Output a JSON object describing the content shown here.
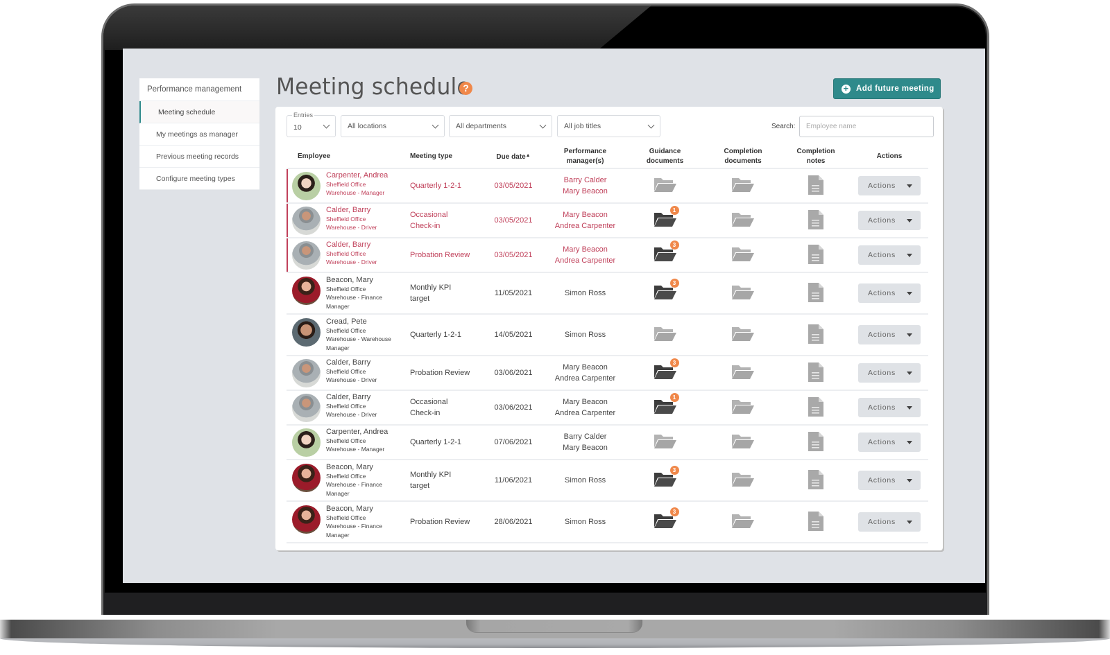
{
  "sidebar": {
    "header": "Performance management",
    "items": [
      {
        "label": "Meeting schedule",
        "active": true
      },
      {
        "label": "My meetings as manager",
        "active": false
      },
      {
        "label": "Previous meeting records",
        "active": false
      },
      {
        "label": "Configure meeting types",
        "active": false
      }
    ]
  },
  "header": {
    "title": "Meeting schedule",
    "help_icon": "?",
    "add_button_label": "Add future meeting",
    "add_button_icon": "plus-circle-icon"
  },
  "filters": {
    "entries_legend": "Entries",
    "entries_value": "10",
    "location": "All locations",
    "department": "All departments",
    "job_title": "All job titles",
    "search_label": "Search:",
    "search_placeholder": "Employee name",
    "search_value": ""
  },
  "table": {
    "columns": [
      "Employee",
      "Meeting type",
      "Due date",
      [
        "Performance",
        "manager(s)"
      ],
      [
        "Guidance",
        "documents"
      ],
      [
        "Completion",
        "documents"
      ],
      [
        "Completion",
        "notes"
      ],
      "Actions"
    ],
    "sort_column": "Due date",
    "sort_direction": "ascending",
    "action_label": "Actions",
    "rows": [
      {
        "name": "Carpenter, Andrea",
        "office": "Sheffield Office",
        "role": [
          "Warehouse - Manager"
        ],
        "avatar": "andrea",
        "type": [
          "Quarterly 1-2-1"
        ],
        "due": "03/05/2021",
        "managers": [
          "Barry Calder",
          "Mary Beacon"
        ],
        "guidance_count": 0,
        "overdue": true
      },
      {
        "name": "Calder, Barry",
        "office": "Sheffield Office",
        "role": [
          "Warehouse - Driver"
        ],
        "avatar": "barry",
        "type": [
          "Occasional",
          "Check-in"
        ],
        "due": "03/05/2021",
        "managers": [
          "Mary Beacon",
          "Andrea Carpenter"
        ],
        "guidance_count": 1,
        "overdue": true
      },
      {
        "name": "Calder, Barry",
        "office": "Sheffield Office",
        "role": [
          "Warehouse - Driver"
        ],
        "avatar": "barry",
        "type": [
          "Probation Review"
        ],
        "due": "03/05/2021",
        "managers": [
          "Mary Beacon",
          "Andrea Carpenter"
        ],
        "guidance_count": 3,
        "overdue": true
      },
      {
        "name": "Beacon, Mary",
        "office": "Sheffield Office",
        "role": [
          "Warehouse - Finance",
          "Manager"
        ],
        "avatar": "mary",
        "type": [
          "Monthly KPI",
          "target"
        ],
        "due": "11/05/2021",
        "managers": [
          "Simon Ross"
        ],
        "guidance_count": 3,
        "overdue": false
      },
      {
        "name": "Cread, Pete",
        "office": "Sheffield Office",
        "role": [
          "Warehouse - Warehouse",
          "Manager"
        ],
        "avatar": "pete",
        "type": [
          "Quarterly 1-2-1"
        ],
        "due": "14/05/2021",
        "managers": [
          "Simon Ross"
        ],
        "guidance_count": 0,
        "overdue": false
      },
      {
        "name": "Calder, Barry",
        "office": "Sheffield Office",
        "role": [
          "Warehouse - Driver"
        ],
        "avatar": "barry",
        "type": [
          "Probation Review"
        ],
        "due": "03/06/2021",
        "managers": [
          "Mary Beacon",
          "Andrea Carpenter"
        ],
        "guidance_count": 3,
        "overdue": false
      },
      {
        "name": "Calder, Barry",
        "office": "Sheffield Office",
        "role": [
          "Warehouse - Driver"
        ],
        "avatar": "barry",
        "type": [
          "Occasional",
          "Check-in"
        ],
        "due": "03/06/2021",
        "managers": [
          "Mary Beacon",
          "Andrea Carpenter"
        ],
        "guidance_count": 1,
        "overdue": false
      },
      {
        "name": "Carpenter, Andrea",
        "office": "Sheffield Office",
        "role": [
          "Warehouse - Manager"
        ],
        "avatar": "andrea",
        "type": [
          "Quarterly 1-2-1"
        ],
        "due": "07/06/2021",
        "managers": [
          "Barry Calder",
          "Mary Beacon"
        ],
        "guidance_count": 0,
        "overdue": false
      },
      {
        "name": "Beacon, Mary",
        "office": "Sheffield Office",
        "role": [
          "Warehouse - Finance",
          "Manager"
        ],
        "avatar": "mary",
        "type": [
          "Monthly KPI",
          "target"
        ],
        "due": "11/06/2021",
        "managers": [
          "Simon Ross"
        ],
        "guidance_count": 3,
        "overdue": false
      },
      {
        "name": "Beacon, Mary",
        "office": "Sheffield Office",
        "role": [
          "Warehouse - Finance",
          "Manager"
        ],
        "avatar": "mary",
        "type": [
          "Probation Review"
        ],
        "due": "28/06/2021",
        "managers": [
          "Simon Ross"
        ],
        "guidance_count": 3,
        "overdue": false
      }
    ]
  },
  "colors": {
    "accent": "#2f8a8b",
    "overdue": "#c0405a",
    "badge": "#f0884a",
    "folder_active": "#474747",
    "folder_empty": "#a9a9a9"
  }
}
